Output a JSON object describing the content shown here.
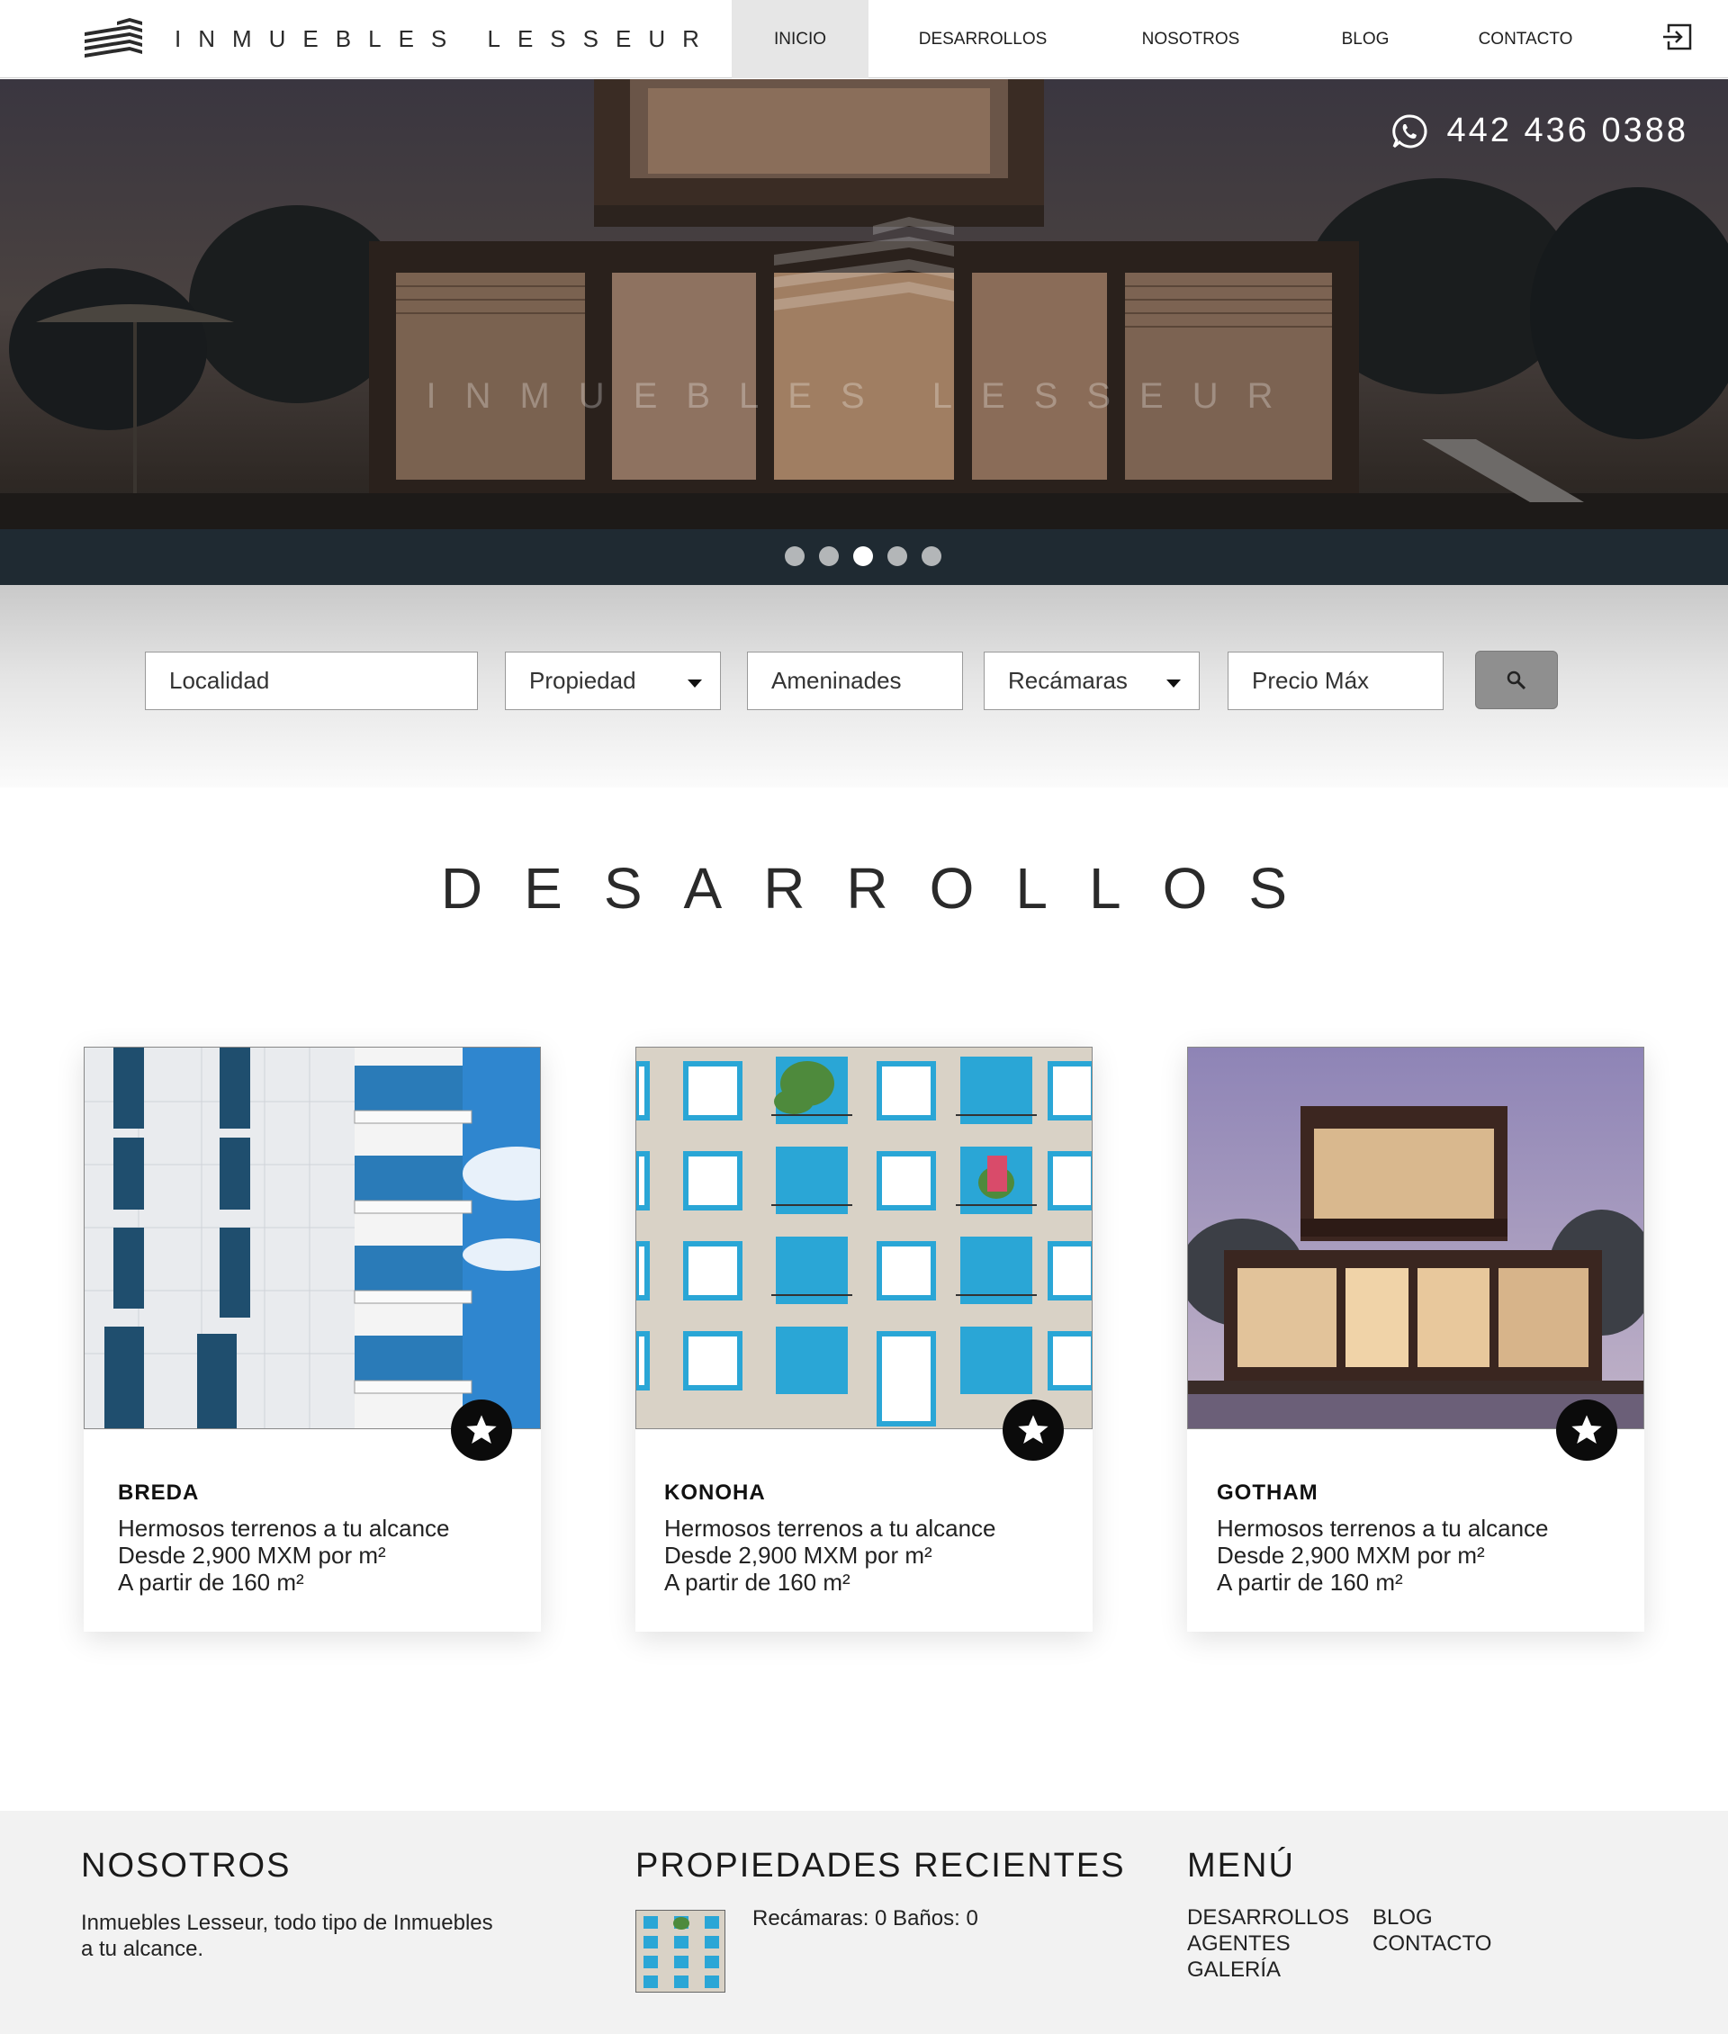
{
  "header": {
    "brand": "INMUEBLES LESSEUR",
    "nav": [
      {
        "label": "INICIO"
      },
      {
        "label": "DESARROLLOS"
      },
      {
        "label": "NOSOTROS"
      },
      {
        "label": "BLOG"
      },
      {
        "label": "CONTACTO"
      }
    ],
    "active_nav": "INICIO",
    "login_icon": "login-icon"
  },
  "hero": {
    "phone": "442 436 0388",
    "phone_icon": "whatsapp-icon",
    "watermark": "INMUEBLES LESSEUR",
    "slides_count": 5,
    "active_slide": 3
  },
  "search": {
    "localidad": "Localidad",
    "propiedad": "Propiedad",
    "amenidades": "Ameninades",
    "recamaras": "Recámaras",
    "precio": "Precio Máx",
    "button_icon": "search-icon"
  },
  "section_title": "DESARROLLOS",
  "cards": [
    {
      "name": "BREDA",
      "line1": "Hermosos terrenos a tu alcance",
      "line2": "Desde 2,900 MXM por m²",
      "line3": "A partir de 160 m²"
    },
    {
      "name": "KONOHA",
      "line1": "Hermosos terrenos a tu alcance",
      "line2": "Desde 2,900 MXM por m²",
      "line3": "A partir de 160 m²"
    },
    {
      "name": "GOTHAM",
      "line1": "Hermosos terrenos a tu alcance",
      "line2": "Desde 2,900 MXM por m²",
      "line3": "A partir de 160 m²"
    }
  ],
  "footer": {
    "about_title": "NOSOTROS",
    "about_line1": "Inmuebles Lesseur, todo tipo de Inmuebles",
    "about_line2": "a tu alcance.",
    "recent_title": "PROPIEDADES RECIENTES",
    "recent_item": "Recámaras: 0 Baños: 0",
    "menu_title": "MENÚ",
    "menu": [
      "DESARROLLOS",
      "AGENTES",
      "GALERÍA",
      "BLOG",
      "CONTACTO"
    ]
  },
  "colors": {
    "accent_gray": "#8f8f8f",
    "nav_active_bg": "#e6e6e6",
    "footer_bg": "#f2f2f2",
    "balcony_blue": "#2aa6d6"
  }
}
